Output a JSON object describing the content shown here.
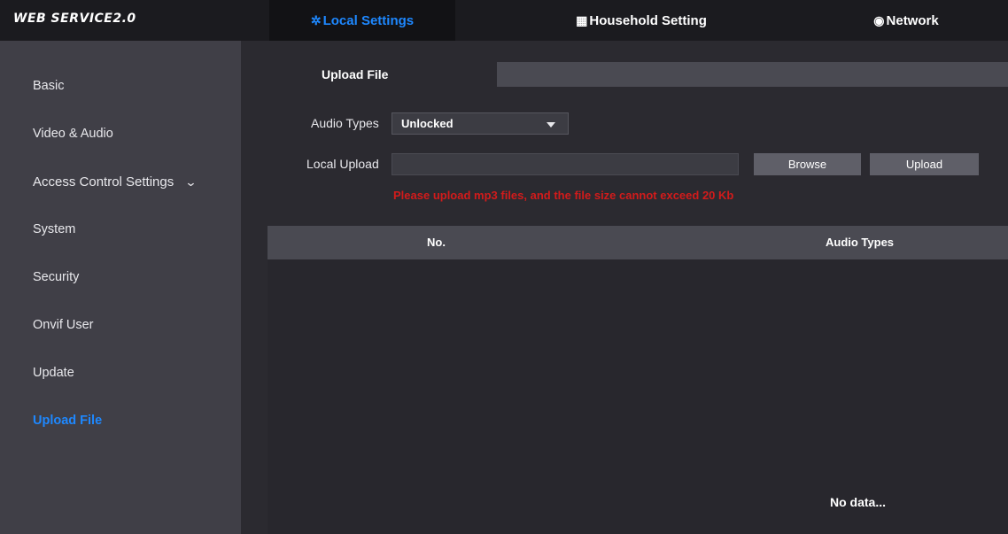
{
  "app": {
    "title": "WEB SERVICE2.0"
  },
  "nav": {
    "local_settings": {
      "icon": "gear-icon",
      "label": "Local Settings"
    },
    "household_setting": {
      "icon": "building-icon",
      "label": "Household Setting"
    },
    "network": {
      "icon": "globe-icon",
      "label": "Network"
    }
  },
  "sidebar": {
    "items": [
      {
        "label": "Basic"
      },
      {
        "label": "Video & Audio"
      },
      {
        "label": "Access Control Settings"
      },
      {
        "label": "System"
      },
      {
        "label": "Security"
      },
      {
        "label": "Onvif User"
      },
      {
        "label": "Update"
      },
      {
        "label": "Upload File"
      }
    ],
    "active": "Upload File"
  },
  "tab": {
    "label": "Upload File"
  },
  "form": {
    "audio_types_label": "Audio Types",
    "audio_types_value": "Unlocked",
    "local_upload_label": "Local Upload",
    "local_upload_value": "",
    "browse_label": "Browse",
    "upload_label": "Upload",
    "warning": "Please upload mp3 files, and the file size cannot exceed 20 Kb"
  },
  "table": {
    "columns": [
      "No.",
      "Audio Types"
    ],
    "rows": [],
    "empty_text": "No data..."
  },
  "colors": {
    "accent": "#1e88ff",
    "warning": "#d21b1b",
    "topbar": "#1b1b1f",
    "sidebar": "#403f47",
    "main": "#2b2a30"
  }
}
